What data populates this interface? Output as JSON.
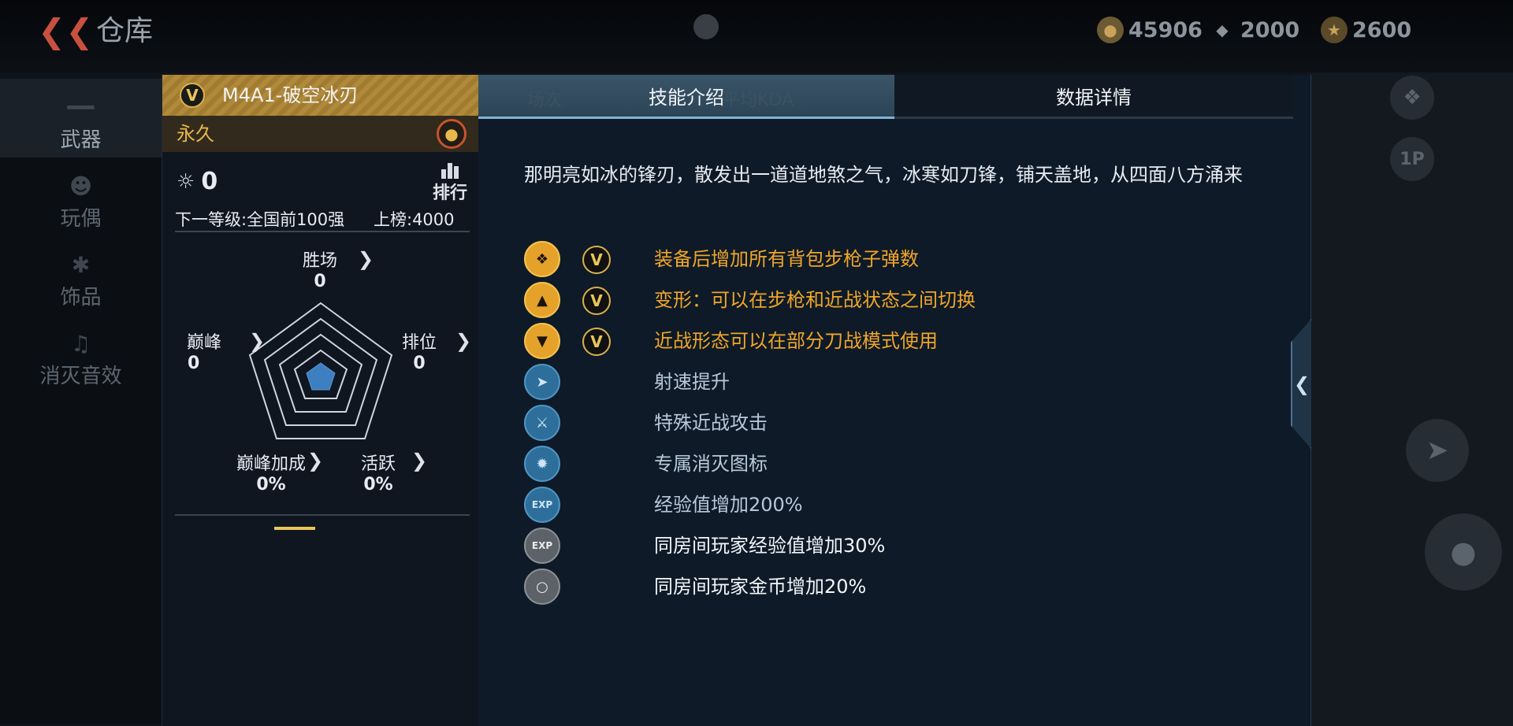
{
  "header": {
    "title": "仓库",
    "currencies": [
      {
        "icon": "coin-icon",
        "value": "45906"
      },
      {
        "icon": "diamond-icon",
        "value": "2000"
      },
      {
        "icon": "token-icon",
        "value": "2600"
      }
    ]
  },
  "sidebar": {
    "items": [
      {
        "label": "武器",
        "icon": "rifle-icon",
        "active": true
      },
      {
        "label": "玩偶",
        "icon": "doll-icon",
        "active": false
      },
      {
        "label": "饰品",
        "icon": "accessory-icon",
        "active": false
      },
      {
        "label": "消灭音效",
        "icon": "sound-icon",
        "active": false
      }
    ]
  },
  "weapon": {
    "badge": "V",
    "name": "M4A1-破空冰刃",
    "duration": "永久",
    "kills": "0",
    "rank_label": "排行",
    "next_level": "下一等级:全国前100强",
    "board": "上榜:4000",
    "stats": {
      "wins": {
        "label": "胜场",
        "value": "0"
      },
      "peak": {
        "label": "巅峰",
        "value": "0"
      },
      "ranked": {
        "label": "排位",
        "value": "0"
      },
      "peak_bonus": {
        "label": "巅峰加成",
        "value": "0%"
      },
      "active": {
        "label": "活跃",
        "value": "0%"
      }
    }
  },
  "panel": {
    "tabs": [
      {
        "label": "技能介绍",
        "active": true
      },
      {
        "label": "数据详情",
        "active": false
      }
    ],
    "ghost": {
      "sessions": "场次",
      "kda": "平均KDA"
    },
    "description": "那明亮如冰的锋刃，散发出一道道地煞之气，冰寒如刀锋，铺天盖地，从四面八方涌来",
    "skills": [
      {
        "icon": "rifle-ammo-icon",
        "style": "gold",
        "vip": true,
        "text": "装备后增加所有背包步枪子弹数"
      },
      {
        "icon": "transform-icon",
        "style": "gold",
        "vip": true,
        "text": "变形：可以在步枪和近战状态之间切换"
      },
      {
        "icon": "melee-mode-icon",
        "style": "gold",
        "vip": true,
        "text": "近战形态可以在部分刀战模式使用"
      },
      {
        "icon": "fire-rate-icon",
        "style": "blue",
        "vip": false,
        "text": "射速提升"
      },
      {
        "icon": "special-melee-icon",
        "style": "blue",
        "vip": false,
        "text": "特殊近战攻击"
      },
      {
        "icon": "kill-icon",
        "style": "blue",
        "vip": false,
        "text": "专属消灭图标"
      },
      {
        "icon": "exp-icon",
        "style": "blue",
        "vip": false,
        "text": "经验值增加200%"
      },
      {
        "icon": "room-exp-icon",
        "style": "gray",
        "vip": false,
        "text": "同房间玩家经验值增加30%"
      },
      {
        "icon": "room-coin-icon",
        "style": "gray",
        "vip": false,
        "text": "同房间玩家金币增加20%"
      }
    ]
  },
  "colors": {
    "gold": "#f0a629",
    "accent": "#7fb4d8",
    "panel": "#0e1a27"
  }
}
